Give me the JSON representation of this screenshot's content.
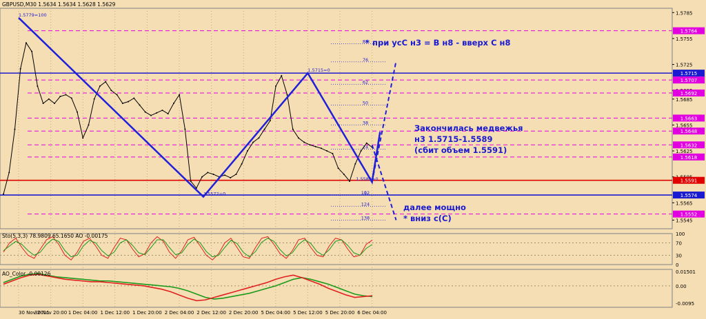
{
  "header": {
    "symbol_line": "GBPUSD,M30  1.5634 1.5634 1.5628 1.5629",
    "sto_line": "Sto(5,3,3) 78.9809 65.1650  AO -0.00175",
    "ao_line": "AO_Color -0.00126"
  },
  "annotations": {
    "scenario": "* при усС н3 = В н8 - вверх С н8",
    "conclusion": [
      "Закончилась медвежья",
      "н3 1.5715-1.5589",
      "(сбит объем 1.5591)"
    ],
    "next_move": [
      "далее мощно",
      "* вниз с(С)"
    ]
  },
  "chart_data": [
    {
      "type": "line",
      "title": "",
      "xlabel": "",
      "ylabel": "",
      "ylim": [
        1.5535,
        1.579
      ],
      "x_ticks": [
        "30 Nov 2011",
        "30 Nov 20:00",
        "1 Dec 04:00",
        "1 Dec 12:00",
        "1 Dec 20:00",
        "2 Dec 04:00",
        "2 Dec 12:00",
        "2 Dec 20:00",
        "5 Dec 04:00",
        "5 Dec 12:00",
        "5 Dec 20:00",
        "6 Dec 04:00"
      ],
      "y_ticks": [
        1.5785,
        1.5755,
        1.5725,
        1.5695,
        1.5685,
        1.5655,
        1.5625,
        1.5595,
        1.5565,
        1.5545
      ],
      "y_tick_labels": [
        "1.5785",
        "1.5755",
        "1.5725",
        "1.5695",
        "1.5685",
        "1.5655",
        "1.5625",
        "1.5595",
        "1.5565",
        "1.5545"
      ],
      "level_badges": [
        {
          "label": "1.5764",
          "value": 1.5764,
          "color": "#e000e0"
        },
        {
          "label": "1.5715",
          "value": 1.5715,
          "color": "#1a1ad0"
        },
        {
          "label": "1.5707",
          "value": 1.5707,
          "color": "#e000e0"
        },
        {
          "label": "1.5692",
          "value": 1.5692,
          "color": "#e000e0"
        },
        {
          "label": "1.5663",
          "value": 1.5663,
          "color": "#e000e0"
        },
        {
          "label": "1.5648",
          "value": 1.5648,
          "color": "#e000e0"
        },
        {
          "label": "1.5632",
          "value": 1.5632,
          "color": "#e000e0"
        },
        {
          "label": "1.5618",
          "value": 1.5618,
          "color": "#e000e0"
        },
        {
          "label": "1.5591",
          "value": 1.5591,
          "color": "#e00000"
        },
        {
          "label": "1.5574",
          "value": 1.5574,
          "color": "#1a1ad0"
        },
        {
          "label": "1.5552",
          "value": 1.5552,
          "color": "#e000e0"
        }
      ],
      "swing_labels": [
        {
          "label": "1.5779=100",
          "x": "30 Nov 2011",
          "value": 1.5779
        },
        {
          "label": "1.5715=0",
          "x": "5 Dec 12:00",
          "value": 1.5715
        },
        {
          "label": "1.5589=0",
          "x": "6 Dec 00:00",
          "value": 1.5589
        },
        {
          "label": "1.5572=0",
          "x": "2 Dec 10:00",
          "value": 1.5572
        }
      ],
      "fib_levels": [
        {
          "label": "88",
          "value": 1.5749
        },
        {
          "label": "76",
          "value": 1.5728
        },
        {
          "label": "62",
          "value": 1.5702
        },
        {
          "label": "50",
          "value": 1.5678
        },
        {
          "label": "38",
          "value": 1.5655
        },
        {
          "label": "24",
          "value": 1.5627
        },
        {
          "label": "0",
          "value": 1.5574
        },
        {
          "label": "112",
          "value": 1.5574
        },
        {
          "label": "124",
          "value": 1.5561
        },
        {
          "label": "138",
          "value": 1.5545
        }
      ],
      "wave_path": {
        "name": "",
        "color": "#2020d8",
        "points": [
          {
            "x": "30 Nov 2011",
            "y": 1.5779
          },
          {
            "x": "2 Dec 10:00",
            "y": 1.5572
          },
          {
            "x": "5 Dec 12:00",
            "y": 1.5715
          },
          {
            "x": "6 Dec 04:00",
            "y": 1.5589
          },
          {
            "x": "6 Dec 06:00",
            "y": 1.5647
          }
        ]
      },
      "projections": [
        {
          "name": "",
          "color": "#2020d8",
          "points": [
            {
              "x": "6 Dec 04:00",
              "y": 1.5589
            },
            {
              "x": "6 Dec 10:00",
              "y": 1.5729
            }
          ]
        },
        {
          "name": "",
          "color": "#2020d8",
          "points": [
            {
              "x": "6 Dec 04:00",
              "y": 1.5632
            },
            {
              "x": "6 Dec 10:00",
              "y": 1.5545
            }
          ]
        }
      ],
      "series": [
        {
          "name": "",
          "color": "#000000",
          "values": [
            1.5575,
            1.56,
            1.565,
            1.572,
            1.575,
            1.574,
            1.57,
            1.568,
            1.5685,
            1.568,
            1.5688,
            1.569,
            1.5686,
            1.567,
            1.564,
            1.5655,
            1.5685,
            1.57,
            1.5705,
            1.5695,
            1.569,
            1.568,
            1.5682,
            1.5686,
            1.5678,
            1.567,
            1.5666,
            1.5669,
            1.5672,
            1.5668,
            1.568,
            1.569,
            1.565,
            1.559,
            1.5582,
            1.5595,
            1.56,
            1.5598,
            1.5595,
            1.5597,
            1.5594,
            1.5598,
            1.561,
            1.5625,
            1.5635,
            1.564,
            1.565,
            1.566,
            1.57,
            1.5712,
            1.569,
            1.565,
            1.564,
            1.5635,
            1.5632,
            1.563,
            1.5628,
            1.5625,
            1.5622,
            1.5605,
            1.5598,
            1.559,
            1.561,
            1.5625,
            1.5634,
            1.5629
          ]
        }
      ]
    },
    {
      "type": "line",
      "title": "Sto(5,3,3) 78.9809 65.1650",
      "ylim": [
        0,
        100
      ],
      "y_ticks": [
        100,
        70,
        30,
        0
      ],
      "y_tick_labels": [
        "100",
        "70",
        "30",
        "0"
      ],
      "series": [
        {
          "name": "",
          "color": "#e02020",
          "values": [
            40,
            70,
            85,
            55,
            30,
            20,
            50,
            80,
            90,
            65,
            30,
            15,
            40,
            75,
            85,
            60,
            30,
            20,
            55,
            85,
            80,
            50,
            25,
            35,
            70,
            90,
            75,
            40,
            20,
            45,
            80,
            88,
            60,
            30,
            15,
            35,
            70,
            85,
            55,
            25,
            20,
            55,
            85,
            90,
            65,
            35,
            20,
            45,
            80,
            85,
            55,
            30,
            25,
            60,
            85,
            80,
            50,
            25,
            30,
            65,
            79
          ]
        },
        {
          "name": "",
          "color": "#1a9a1a",
          "values": [
            45,
            60,
            75,
            65,
            45,
            30,
            40,
            65,
            82,
            75,
            45,
            25,
            30,
            60,
            78,
            70,
            45,
            28,
            40,
            70,
            80,
            62,
            38,
            32,
            55,
            80,
            80,
            55,
            32,
            38,
            65,
            82,
            70,
            42,
            25,
            30,
            55,
            78,
            68,
            40,
            25,
            42,
            72,
            85,
            75,
            48,
            28,
            38,
            65,
            80,
            68,
            42,
            30,
            48,
            75,
            80,
            62,
            38,
            30,
            52,
            65
          ]
        }
      ]
    },
    {
      "type": "bar",
      "title": "AO_Color -0.00126",
      "ylim": [
        -0.0026,
        0.002
      ],
      "y_ticks": [
        0.015,
        0.0,
        -0.0095
      ],
      "y_tick_labels": [
        "0.01501",
        "0.00",
        "-0.0095"
      ],
      "series": [
        {
          "name": "",
          "color": "#1a9a1a",
          "values": [
            0.0004,
            0.0008,
            0.0012,
            0.0014,
            0.0015,
            0.0013,
            0.0011,
            0.001,
            0.0009,
            0.0008,
            0.0007,
            0.0006,
            0.0006,
            0.0005,
            0.0004,
            0.0003,
            0.0002,
            0.0001,
            0.0,
            -0.0001,
            -0.0003,
            -0.0006,
            -0.001,
            -0.0014,
            -0.0016,
            -0.0015,
            -0.0013,
            -0.0011,
            -0.0009,
            -0.0006,
            -0.0003,
            0.0,
            0.0004,
            0.0008,
            0.001,
            0.0008,
            0.0005,
            0.0002,
            -0.0002,
            -0.0006,
            -0.001,
            -0.0012,
            -0.0013
          ]
        },
        {
          "name": "",
          "color": "#e02020",
          "values": [
            0.0002,
            0.0006,
            0.001,
            0.0013,
            0.0014,
            0.0012,
            0.001,
            0.0008,
            0.0007,
            0.0006,
            0.0005,
            0.0005,
            0.0004,
            0.0003,
            0.0002,
            0.0001,
            0.0,
            -0.0002,
            -0.0004,
            -0.0007,
            -0.0011,
            -0.0015,
            -0.0018,
            -0.0017,
            -0.0014,
            -0.0011,
            -0.0008,
            -0.0005,
            -0.0002,
            0.0001,
            0.0004,
            0.0008,
            0.0011,
            0.0013,
            0.001,
            0.0006,
            0.0002,
            -0.0003,
            -0.0007,
            -0.0011,
            -0.0014,
            -0.0013,
            -0.0012
          ]
        }
      ]
    }
  ]
}
